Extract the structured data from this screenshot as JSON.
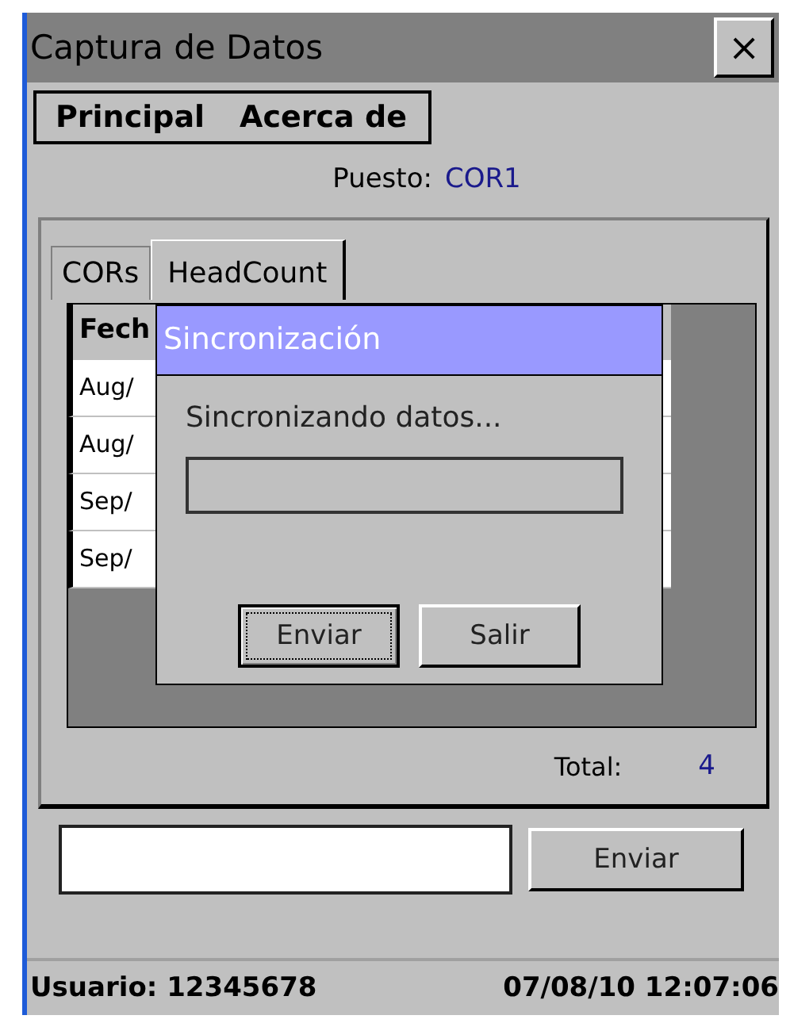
{
  "window": {
    "title": "Captura de Datos",
    "close": "×"
  },
  "menu": [
    {
      "label": "Principal"
    },
    {
      "label": "Acerca de"
    }
  ],
  "station": {
    "label": "Puesto:",
    "value": "COR1"
  },
  "tabs": [
    {
      "label": "CORs",
      "selected": false
    },
    {
      "label": "HeadCount",
      "selected": true
    }
  ],
  "table": {
    "columns": [
      "Fech"
    ],
    "rows": [
      [
        "Aug/"
      ],
      [
        "Aug/"
      ],
      [
        "Sep/"
      ],
      [
        "Sep/"
      ]
    ]
  },
  "total": {
    "label": "Total:",
    "value": "4"
  },
  "send_button": "Enviar",
  "dialog": {
    "title": "Sincronización",
    "message": "Sincronizando datos...",
    "progress": {
      "level": 0
    },
    "buttons": [
      {
        "label": "Enviar",
        "focused": true
      },
      {
        "label": "Salir",
        "focused": false
      }
    ]
  },
  "status_bar": {
    "user": "Usuario: 12345678",
    "datetime": "07/08/10 12:07:06"
  }
}
